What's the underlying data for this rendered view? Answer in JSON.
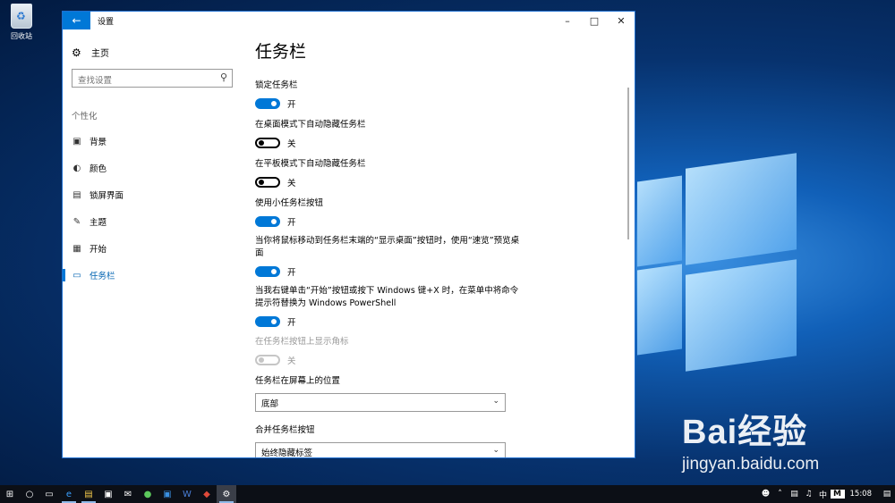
{
  "desktop": {
    "recycle_bin_label": "回收站",
    "watermark_top": "Bai经验",
    "watermark_bottom": "jingyan.baidu.com"
  },
  "window": {
    "title": "设置",
    "back_icon": "back-arrow-icon",
    "controls": [
      "minimize",
      "maximize",
      "close"
    ]
  },
  "sidebar": {
    "home_label": "主页",
    "search_placeholder": "查找设置",
    "section_label": "个性化",
    "items": [
      {
        "label": "背景",
        "icon": "picture-icon"
      },
      {
        "label": "颜色",
        "icon": "palette-icon"
      },
      {
        "label": "锁屏界面",
        "icon": "lock-screen-icon"
      },
      {
        "label": "主题",
        "icon": "theme-icon"
      },
      {
        "label": "开始",
        "icon": "start-icon"
      },
      {
        "label": "任务栏",
        "icon": "taskbar-icon",
        "active": true
      }
    ]
  },
  "main": {
    "title": "任务栏",
    "settings": [
      {
        "label": "锁定任务栏",
        "state": "开",
        "on": true
      },
      {
        "label": "在桌面模式下自动隐藏任务栏",
        "state": "关",
        "on": false
      },
      {
        "label": "在平板模式下自动隐藏任务栏",
        "state": "关",
        "on": false
      },
      {
        "label": "使用小任务栏按钮",
        "state": "开",
        "on": true
      },
      {
        "label": "当你将鼠标移动到任务栏末端的“显示桌面”按钮时，使用“速览”预览桌面",
        "state": "开",
        "on": true
      },
      {
        "label": "当我右键单击“开始”按钮或按下 Windows 键+X 时，在菜单中将命令提示符替换为 Windows PowerShell",
        "state": "开",
        "on": true
      },
      {
        "label": "在任务栏按钮上显示角标",
        "state": "关",
        "on": false,
        "disabled": true
      }
    ],
    "position_label": "任务栏在屏幕上的位置",
    "position_value": "底部",
    "combine_label": "合并任务栏按钮",
    "combine_value": "始终隐藏标签"
  },
  "taskbar": {
    "icons": [
      "windows-start-icon",
      "cortana-icon",
      "task-view-icon",
      "edge-icon",
      "file-explorer-icon",
      "store-icon",
      "mail-icon",
      "app-icon",
      "outlook-icon",
      "word-icon",
      "app2-icon",
      "settings-icon"
    ],
    "tray_input_method": "M",
    "tray_lang": "中",
    "clock": "15:08"
  },
  "colors": {
    "accent": "#0078d7",
    "taskbar_bg": "#0c0f16"
  }
}
